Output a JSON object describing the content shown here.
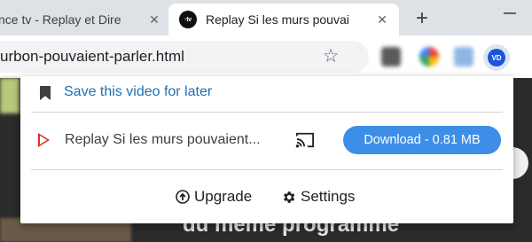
{
  "browser": {
    "tabs": [
      {
        "title": "nce tv - Replay et Dire",
        "active": false,
        "close_symbol": "✕"
      },
      {
        "title": "Replay Si les murs pouvai",
        "active": true,
        "favicon_text": "·tv",
        "close_symbol": "✕"
      }
    ],
    "new_tab_symbol": "+",
    "url": "urbon-pouvaient-parler.html",
    "bookmark_star_symbol": "☆",
    "active_extension_text": "VD"
  },
  "background_page": {
    "partial_text": "du meme programme"
  },
  "popup": {
    "save_label": "Save this video for later",
    "video_title": "Replay Si les murs pouvaient...",
    "download_label": "Download - 0.81 MB",
    "upgrade_label": "Upgrade",
    "settings_label": "Settings",
    "colors": {
      "accent": "#3d8ee6",
      "link": "#1f6fb5",
      "play_icon": "#e03024"
    }
  }
}
